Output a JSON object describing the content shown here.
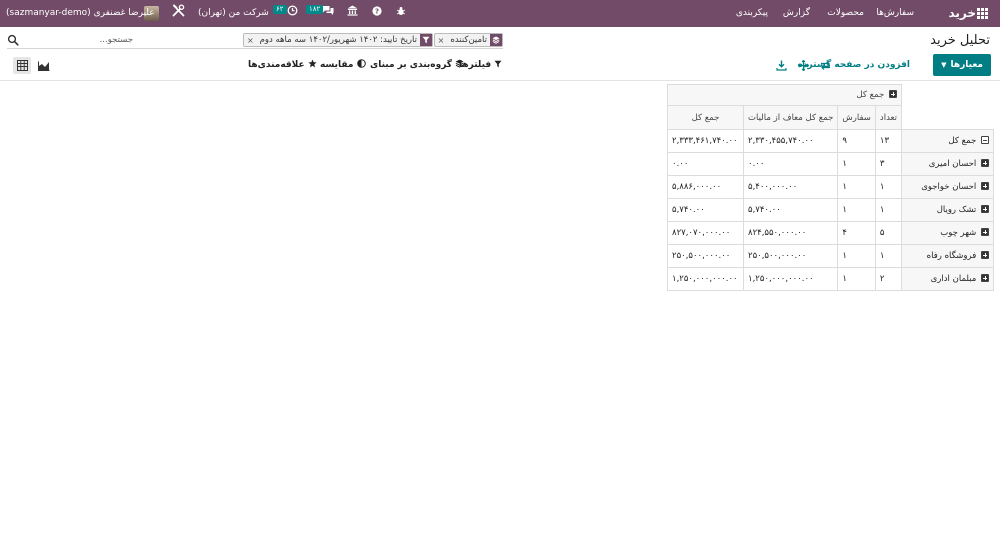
{
  "topbar": {
    "app_name": "خرید",
    "menus": [
      "سفارش‌ها",
      "محصولات",
      "گزارش",
      "پیکربندی"
    ],
    "company": "شرکت من (تهران)",
    "activity_count": "۶۲",
    "messages_count": "۱۸۲",
    "user_name": "علیرضا غضنفری",
    "database": "(sazmanyar-demo)"
  },
  "page": {
    "title": "تحلیل خرید"
  },
  "search": {
    "facets": [
      {
        "icon": "layers-icon",
        "label": "تامین‌کننده"
      },
      {
        "icon": "filter-icon",
        "label": "تاریخ تایید: ۱۴۰۲ شهریور/۱۴۰۲ سه ماهه دوم"
      }
    ],
    "placeholder": "جستجو..."
  },
  "control_panel": {
    "measures_label": "معیارها",
    "insert_label": "افزودن در صفحه گسترده",
    "filters_label": "فیلترها",
    "groupby_label": "گروه‌بندی بر مبنای",
    "compare_label": "مقایسه",
    "favorites_label": "علاقه‌مندی‌ها"
  },
  "pivot": {
    "col_header": "جمع کل",
    "measures": [
      "تعداد",
      "سفارش",
      "جمع کل معاف از مالیات",
      "جمع کل"
    ],
    "total_row": {
      "label": "جمع کل",
      "values": [
        "۱۳",
        "۹",
        "۲,۳۳۰,۴۵۵,۷۴۰.۰۰",
        "۲,۳۳۳,۴۶۱,۷۴۰.۰۰"
      ]
    },
    "rows": [
      {
        "label": "احسان امیری",
        "values": [
          "۳",
          "۱",
          "۰.۰۰",
          "۰.۰۰"
        ]
      },
      {
        "label": "احسان خواجوی",
        "values": [
          "۱",
          "۱",
          "۵,۴۰۰,۰۰۰.۰۰",
          "۵,۸۸۶,۰۰۰.۰۰"
        ]
      },
      {
        "label": "تشک رویال",
        "values": [
          "۱",
          "۱",
          "۵,۷۴۰.۰۰",
          "۵,۷۴۰.۰۰"
        ]
      },
      {
        "label": "شهر چوب",
        "values": [
          "۵",
          "۴",
          "۸۲۴,۵۵۰,۰۰۰.۰۰",
          "۸۲۷,۰۷۰,۰۰۰.۰۰"
        ]
      },
      {
        "label": "فروشگاه رفاه",
        "values": [
          "۱",
          "۱",
          "۲۵۰,۵۰۰,۰۰۰.۰۰",
          "۲۵۰,۵۰۰,۰۰۰.۰۰"
        ]
      },
      {
        "label": "مبلمان اداری",
        "values": [
          "۲",
          "۱",
          "۱,۲۵۰,۰۰۰,۰۰۰.۰۰",
          "۱,۲۵۰,۰۰۰,۰۰۰.۰۰"
        ]
      }
    ]
  }
}
